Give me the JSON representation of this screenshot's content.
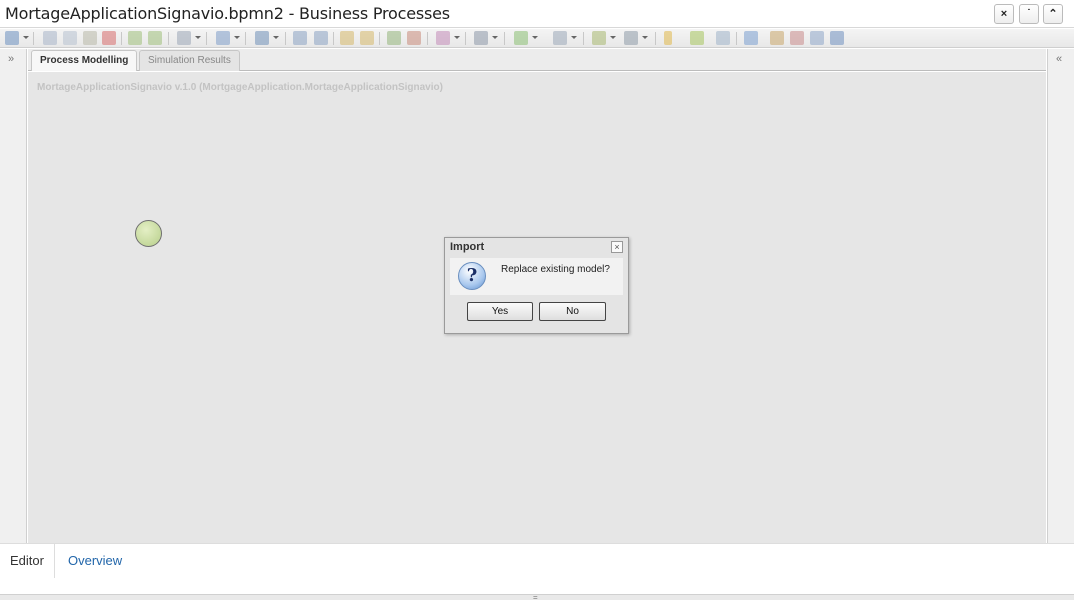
{
  "window": {
    "title": "MortageApplicationSignavio.bpmn2 - Business Processes",
    "buttons": {
      "close": "×",
      "minimize": "˙",
      "maximize": "⌃"
    }
  },
  "toolbar": {
    "items": [
      "save",
      "cut",
      "copy",
      "paste",
      "delete",
      "undo",
      "redo",
      "history",
      "view",
      "deploy",
      "select-all",
      "unselect",
      "lock",
      "unlock",
      "add-docker",
      "remove-docker",
      "layout",
      "properties",
      "import",
      "tools",
      "align",
      "simulation",
      "zoom",
      "color",
      "edit",
      "fit",
      "export",
      "prev",
      "next",
      "viewport",
      "fullscreen"
    ]
  },
  "sidebar": {
    "left_toggle": "»",
    "right_toggle": "«"
  },
  "tabs": {
    "process_modelling": "Process Modelling",
    "simulation_results": "Simulation Results"
  },
  "canvas": {
    "caption": "MortageApplicationSignavio v.1.0 (MortgageApplication.MortageApplicationSignavio)"
  },
  "dialog": {
    "title": "Import",
    "close": "×",
    "message": "Replace existing model?",
    "icon": "?",
    "yes_label": "Yes",
    "no_label": "No"
  },
  "bottom_tabs": {
    "editor": "Editor",
    "overview": "Overview"
  },
  "statusbar": {
    "grip": "="
  },
  "colors": {
    "start_event": "#c6dba0",
    "link": "#2266aa",
    "canvas": "#e6e6e6"
  }
}
